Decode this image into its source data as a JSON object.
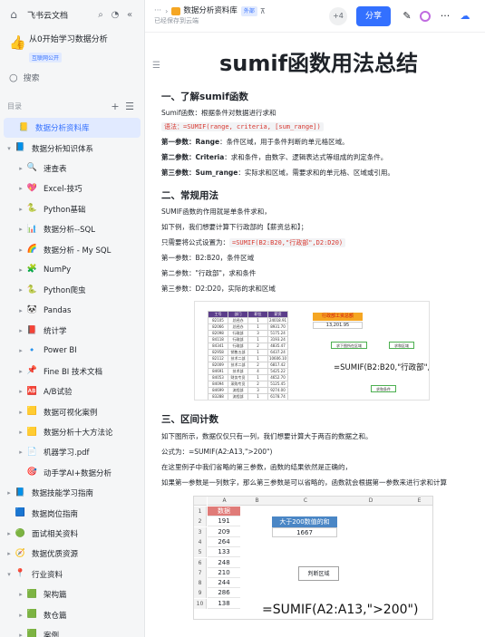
{
  "app": {
    "title": "飞书云文档"
  },
  "space": {
    "name": "从0开始学习数据分析",
    "badge": "互联网公开"
  },
  "search": {
    "placeholder": "搜索"
  },
  "toc": {
    "label": "目录"
  },
  "tree": [
    {
      "label": "数据分析资料库",
      "level": 0,
      "selected": true,
      "caret": "",
      "icon": "📒",
      "color": "#f5a623"
    },
    {
      "label": "数据分析知识体系",
      "level": 0,
      "caret": "▾",
      "icon": "📘",
      "color": "#3370ff"
    },
    {
      "label": "速查表",
      "level": 1,
      "caret": "▸",
      "icon": "🔍",
      "color": ""
    },
    {
      "label": "Excel-技巧",
      "level": 1,
      "caret": "▸",
      "icon": "💖",
      "color": ""
    },
    {
      "label": "Python基础",
      "level": 1,
      "caret": "▸",
      "icon": "🐍",
      "color": ""
    },
    {
      "label": "数据分析--SQL",
      "level": 1,
      "caret": "▸",
      "icon": "📊",
      "color": ""
    },
    {
      "label": "数据分析 - My SQL",
      "level": 1,
      "caret": "▸",
      "icon": "🌈",
      "color": ""
    },
    {
      "label": "NumPy",
      "level": 1,
      "caret": "▸",
      "icon": "🧩",
      "color": ""
    },
    {
      "label": "Python爬虫",
      "level": 1,
      "caret": "▸",
      "icon": "🐍",
      "color": ""
    },
    {
      "label": "Pandas",
      "level": 1,
      "caret": "▸",
      "icon": "🐼",
      "color": ""
    },
    {
      "label": "统计学",
      "level": 1,
      "caret": "▸",
      "icon": "📕",
      "color": ""
    },
    {
      "label": "Power BI",
      "level": 1,
      "caret": "▸",
      "icon": "🔹",
      "color": ""
    },
    {
      "label": "Fine BI 技术文档",
      "level": 1,
      "caret": "▸",
      "icon": "📌",
      "color": ""
    },
    {
      "label": "A/B试验",
      "level": 1,
      "caret": "▸",
      "icon": "🆎",
      "color": ""
    },
    {
      "label": "数据可视化案例",
      "level": 1,
      "caret": "▸",
      "icon": "🟨",
      "color": ""
    },
    {
      "label": "数据分析十大方法论",
      "level": 1,
      "caret": "▸",
      "icon": "🟨",
      "color": ""
    },
    {
      "label": "机器学习.pdf",
      "level": 1,
      "caret": "▸",
      "icon": "📄",
      "color": ""
    },
    {
      "label": "动手学AI+数据分析",
      "level": 1,
      "caret": "",
      "icon": "🎯",
      "color": ""
    },
    {
      "label": "数据技能学习指南",
      "level": 0,
      "caret": "▸",
      "icon": "📘",
      "color": "#3370ff"
    },
    {
      "label": "数据岗位指南",
      "level": 0,
      "caret": "",
      "icon": "🟦",
      "color": "#3370ff"
    },
    {
      "label": "面试相关资料",
      "level": 0,
      "caret": "▸",
      "icon": "🟢",
      "color": ""
    },
    {
      "label": "数据优质资源",
      "level": 0,
      "caret": "▸",
      "icon": "🧭",
      "color": ""
    },
    {
      "label": "行业资料",
      "level": 0,
      "caret": "▾",
      "icon": "📍",
      "color": ""
    },
    {
      "label": "架构篇",
      "level": 1,
      "caret": "▸",
      "icon": "🟩",
      "color": ""
    },
    {
      "label": "数仓篇",
      "level": 1,
      "caret": "▸",
      "icon": "🟩",
      "color": ""
    },
    {
      "label": "案例",
      "level": 1,
      "caret": "▸",
      "icon": "🟩",
      "color": ""
    },
    {
      "label": "数据可视化",
      "level": 0,
      "caret": "▸",
      "icon": "🚀",
      "color": ""
    }
  ],
  "header": {
    "breadcrumb_dots": "···",
    "breadcrumb_folder": "数据分析资料库",
    "tag": "外部",
    "saved": "已经保存到云端",
    "collaborators": "+4",
    "share_label": "分享"
  },
  "doc": {
    "title": "sumif函数用法总结",
    "s1": {
      "heading": "一、了解sumif函数",
      "intro": "Sumif函数：根据条件对数据进行求和",
      "syntax": "语法：=SUMIF(range, criteria, [sum_range])",
      "p1a": "第一参数：",
      "p1b": "Range",
      "p1c": "：条件区域，用于条件判断的单元格区域。",
      "p2a": "第二参数：",
      "p2b": "Criteria",
      "p2c": "：求和条件，由数字、逻辑表达式等组成的判定条件。",
      "p3a": "第三参数：",
      "p3b": "Sum_range",
      "p3c": "：实际求和区域，需要求和的单元格、区域或引用。"
    },
    "s2": {
      "heading": "二、常规用法",
      "l1": "SUMIF函数的作用就是单条件求和，",
      "l2": "如下例，我们想要计算下行政部的【薪资总和】；",
      "l3a": "只需要将公式设置为：",
      "l3b": "=SUMIF(B2:B20,\"行政部\",D2:D20)",
      "l4": "第一参数：B2:B20，条件区域",
      "l5": "第二参数：\"行政部\"，求和条件",
      "l6": "第三参数：D2:D20，实际的求和区域"
    },
    "s3": {
      "heading": "三、区间计数",
      "l1": "如下图所示，数据仅仅只有一列，我们想要计算大于两百的数据之和。",
      "l2": "公式为：=SUMIF(A2:A13,\">200\")",
      "l3": "在这里例子中我们省略的第三参数，函数的结果依然是正确的，",
      "l4": "如果第一参数是一列数字，那么第三参数是可以省略的，函数就会根据第一参数来进行求和计算"
    }
  },
  "shot1": {
    "headers": [
      "工号",
      "部门",
      "职位",
      "薪资"
    ],
    "rows": [
      [
        "82105",
        "总经办",
        "1",
        "24018.91"
      ],
      [
        "82066",
        "总经办",
        "1",
        "8931.70"
      ],
      [
        "82098",
        "行政部",
        "3",
        "5175.24"
      ],
      [
        "84118",
        "行政部",
        "1",
        "3193.24"
      ],
      [
        "84341",
        "行政部",
        "2",
        "4835.47"
      ],
      [
        "82958",
        "销售五部",
        "1",
        "6437.24"
      ],
      [
        "82112",
        "技术二部",
        "1",
        "10606.10"
      ],
      [
        "82009",
        "技术二部",
        "2",
        "6817.42"
      ],
      [
        "84691",
        "技术部",
        "4",
        "5425.22"
      ],
      [
        "84053",
        "财务专员",
        "1",
        "4652.70"
      ],
      [
        "84094",
        "采购专员",
        "2",
        "5125.45"
      ],
      [
        "84699",
        "流程部",
        "3",
        "9274.00"
      ],
      [
        "83288",
        "流程部",
        "1",
        "6178.74"
      ],
      [
        "83287",
        "运营专员",
        "1",
        "6196.84"
      ],
      [
        "83234",
        "流程总部",
        "1",
        "5330.40"
      ]
    ],
    "result_label": "行政部工资总额",
    "result_value": "13,201.95",
    "box_criteria": "求下图所在区域",
    "box_sum": "求和区域",
    "box_cond": "求和条件",
    "formula": "=SUMIF(B2:B20,\"行政部\",D2:D20)"
  },
  "shot2": {
    "cols": [
      "A",
      "B",
      "C",
      "D",
      "E"
    ],
    "rows": [
      "1",
      "2",
      "3",
      "4",
      "5",
      "6",
      "7",
      "8",
      "9",
      "10"
    ],
    "header": "数据",
    "values": [
      "191",
      "209",
      "264",
      "133",
      "248",
      "210",
      "244",
      "286",
      "138"
    ],
    "blue_label": "大于200数值的和",
    "blue_value": "1667",
    "judge": "判断区域",
    "formula": "=SUMIF(A2:A13,\">200\")"
  }
}
